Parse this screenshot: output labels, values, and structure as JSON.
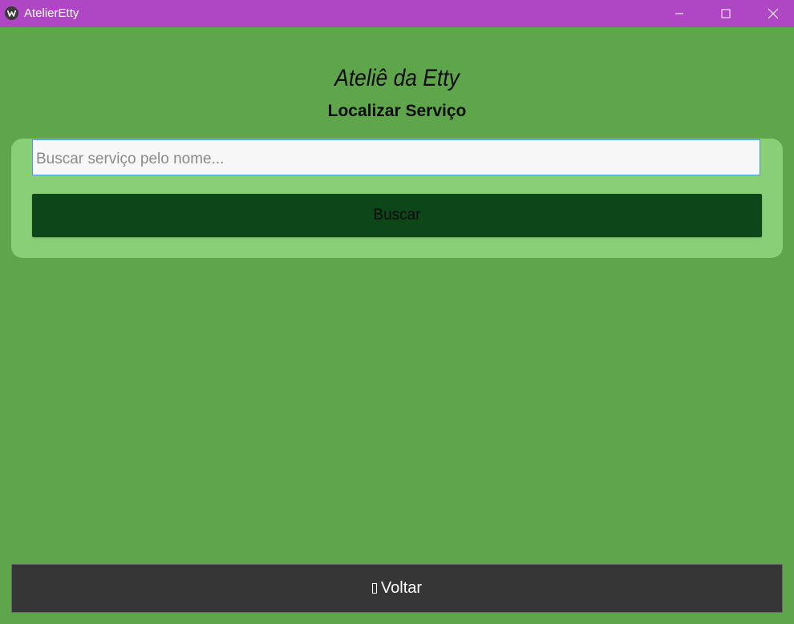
{
  "window": {
    "title": "AtelierEtty",
    "titlebar_color": "#af47c4",
    "app_icon": "kivy-logo-icon",
    "controls": {
      "minimize_icon": "minimize-icon",
      "maximize_icon": "maximize-icon",
      "close_icon": "close-icon"
    }
  },
  "header": {
    "title": "Ateliê da Etty",
    "subtitle": "Localizar Serviço"
  },
  "search": {
    "placeholder": "Buscar serviço pelo nome...",
    "value": "",
    "button_label": "Buscar"
  },
  "footer": {
    "back_label": "Voltar",
    "back_icon": "missing-glyph-icon"
  },
  "colors": {
    "background": "#5fa54c",
    "card": "#89cf77",
    "search_button": "#0c4619",
    "back_button": "#363636"
  }
}
